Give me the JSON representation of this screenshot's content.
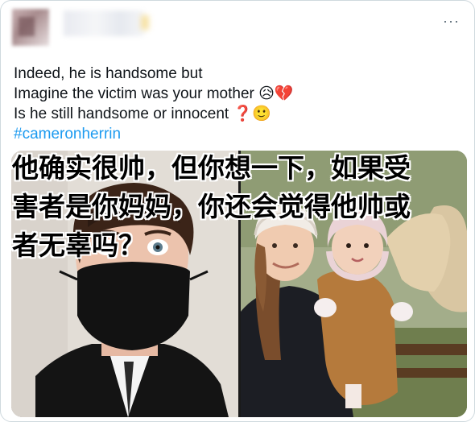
{
  "tweet": {
    "lines": [
      "Indeed, he is handsome but",
      "Imagine the victim was your mother",
      "Is he still handsome or innocent"
    ],
    "emoji_line2": "😥💔",
    "emoji_line3": "❓🙂",
    "hashtag": "#cameronherrin",
    "more_label": "···"
  },
  "overlay": {
    "lines": [
      "他确实很帅，但你想一下，如果受",
      "害者是你妈妈，你还会觉得他帅或",
      "者无辜吗？"
    ]
  },
  "icons": {
    "more": "more-horizontal-icon"
  }
}
